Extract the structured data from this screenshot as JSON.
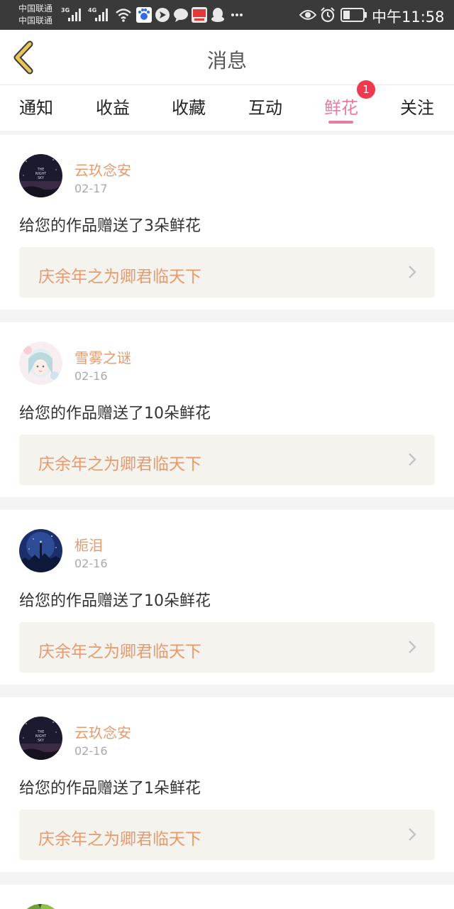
{
  "status_bar": {
    "carrier_1": "中国联通",
    "carrier_2": "中国联通",
    "net_1": "3G",
    "net_2": "4G",
    "time": "中午11:58",
    "icons": [
      "signal-icon",
      "wifi-icon",
      "baidu-icon",
      "navigation-icon",
      "chat-icon",
      "toutiao-icon",
      "qq-icon",
      "more-icon",
      "eye-icon",
      "alarm-icon",
      "battery-icon"
    ]
  },
  "header": {
    "title": "消息",
    "back_icon": "chevron-left-icon"
  },
  "tabs": {
    "items": [
      {
        "label": "通知"
      },
      {
        "label": "收益"
      },
      {
        "label": "收藏"
      },
      {
        "label": "互动"
      },
      {
        "label": "鲜花"
      },
      {
        "label": "关注"
      }
    ],
    "active": "鲜花",
    "badge": "1"
  },
  "colors": {
    "accent_pink": "#e87aa3",
    "accent_orange": "#e9996a",
    "badge_red": "#f0384f",
    "link_bg": "#f5f3ee"
  },
  "messages": [
    {
      "user": "云玖念安",
      "date": "02-17",
      "text": "给您的作品赠送了3朵鲜花",
      "book": "庆余年之为卿君临天下",
      "avatar_text": "THE NIGHT SKY"
    },
    {
      "user": "雪雾之谜",
      "date": "02-16",
      "text": "给您的作品赠送了10朵鲜花",
      "book": "庆余年之为卿君临天下"
    },
    {
      "user": "栀泪",
      "date": "02-16",
      "text": "给您的作品赠送了10朵鲜花",
      "book": "庆余年之为卿君临天下"
    },
    {
      "user": "云玖念安",
      "date": "02-16",
      "text": "给您的作品赠送了1朵鲜花",
      "book": "庆余年之为卿君临天下",
      "avatar_text": "THE NIGHT SKY"
    }
  ]
}
